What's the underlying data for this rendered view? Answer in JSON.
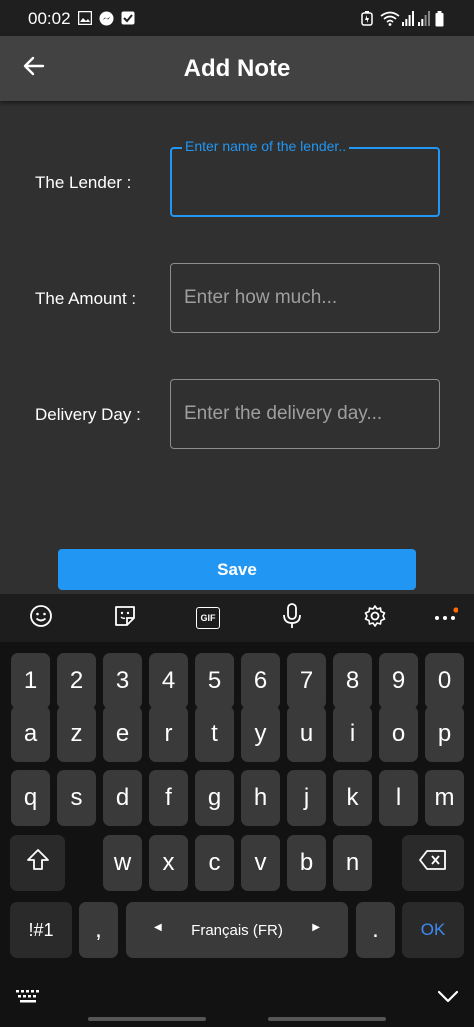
{
  "status_bar": {
    "time": "00:02",
    "left_icons": [
      "image-icon",
      "messenger-icon",
      "checkbox-icon"
    ],
    "right_icons": [
      "battery-saver-icon",
      "wifi-icon",
      "signal-icon",
      "signal-icon",
      "battery-icon"
    ]
  },
  "app_bar": {
    "title": "Add Note",
    "back_icon": "arrow-left-icon"
  },
  "form": {
    "lender": {
      "label": "The Lender :",
      "placeholder": "Enter name of the lender..",
      "value": ""
    },
    "amount": {
      "label": "The Amount :",
      "placeholder": "Enter how much...",
      "value": ""
    },
    "delivery": {
      "label": "Delivery Day :",
      "placeholder": "Enter the delivery day...",
      "value": ""
    },
    "save_label": "Save"
  },
  "keyboard": {
    "toolbar_icons": [
      "emoji-icon",
      "sticker-icon",
      "gif-icon",
      "microphone-icon",
      "settings-icon",
      "more-icon"
    ],
    "gif_text": "GIF",
    "rows": [
      [
        "1",
        "2",
        "3",
        "4",
        "5",
        "6",
        "7",
        "8",
        "9",
        "0"
      ],
      [
        "a",
        "z",
        "e",
        "r",
        "t",
        "y",
        "u",
        "i",
        "o",
        "p"
      ],
      [
        "q",
        "s",
        "d",
        "f",
        "g",
        "h",
        "j",
        "k",
        "l",
        "m"
      ],
      [
        "w",
        "x",
        "c",
        "v",
        "b",
        "n"
      ]
    ],
    "symbols_label": "!#1",
    "comma_label": ",",
    "space_label": "Français (FR)",
    "period_label": ".",
    "ok_label": "OK"
  },
  "colors": {
    "accent": "#2196f3",
    "background": "#303030",
    "app_bar": "#424242",
    "keyboard_bg": "#121212",
    "key_bg": "#3a3a3a",
    "ok_text": "#3d8bf0",
    "notification_dot": "#ff6d00"
  }
}
